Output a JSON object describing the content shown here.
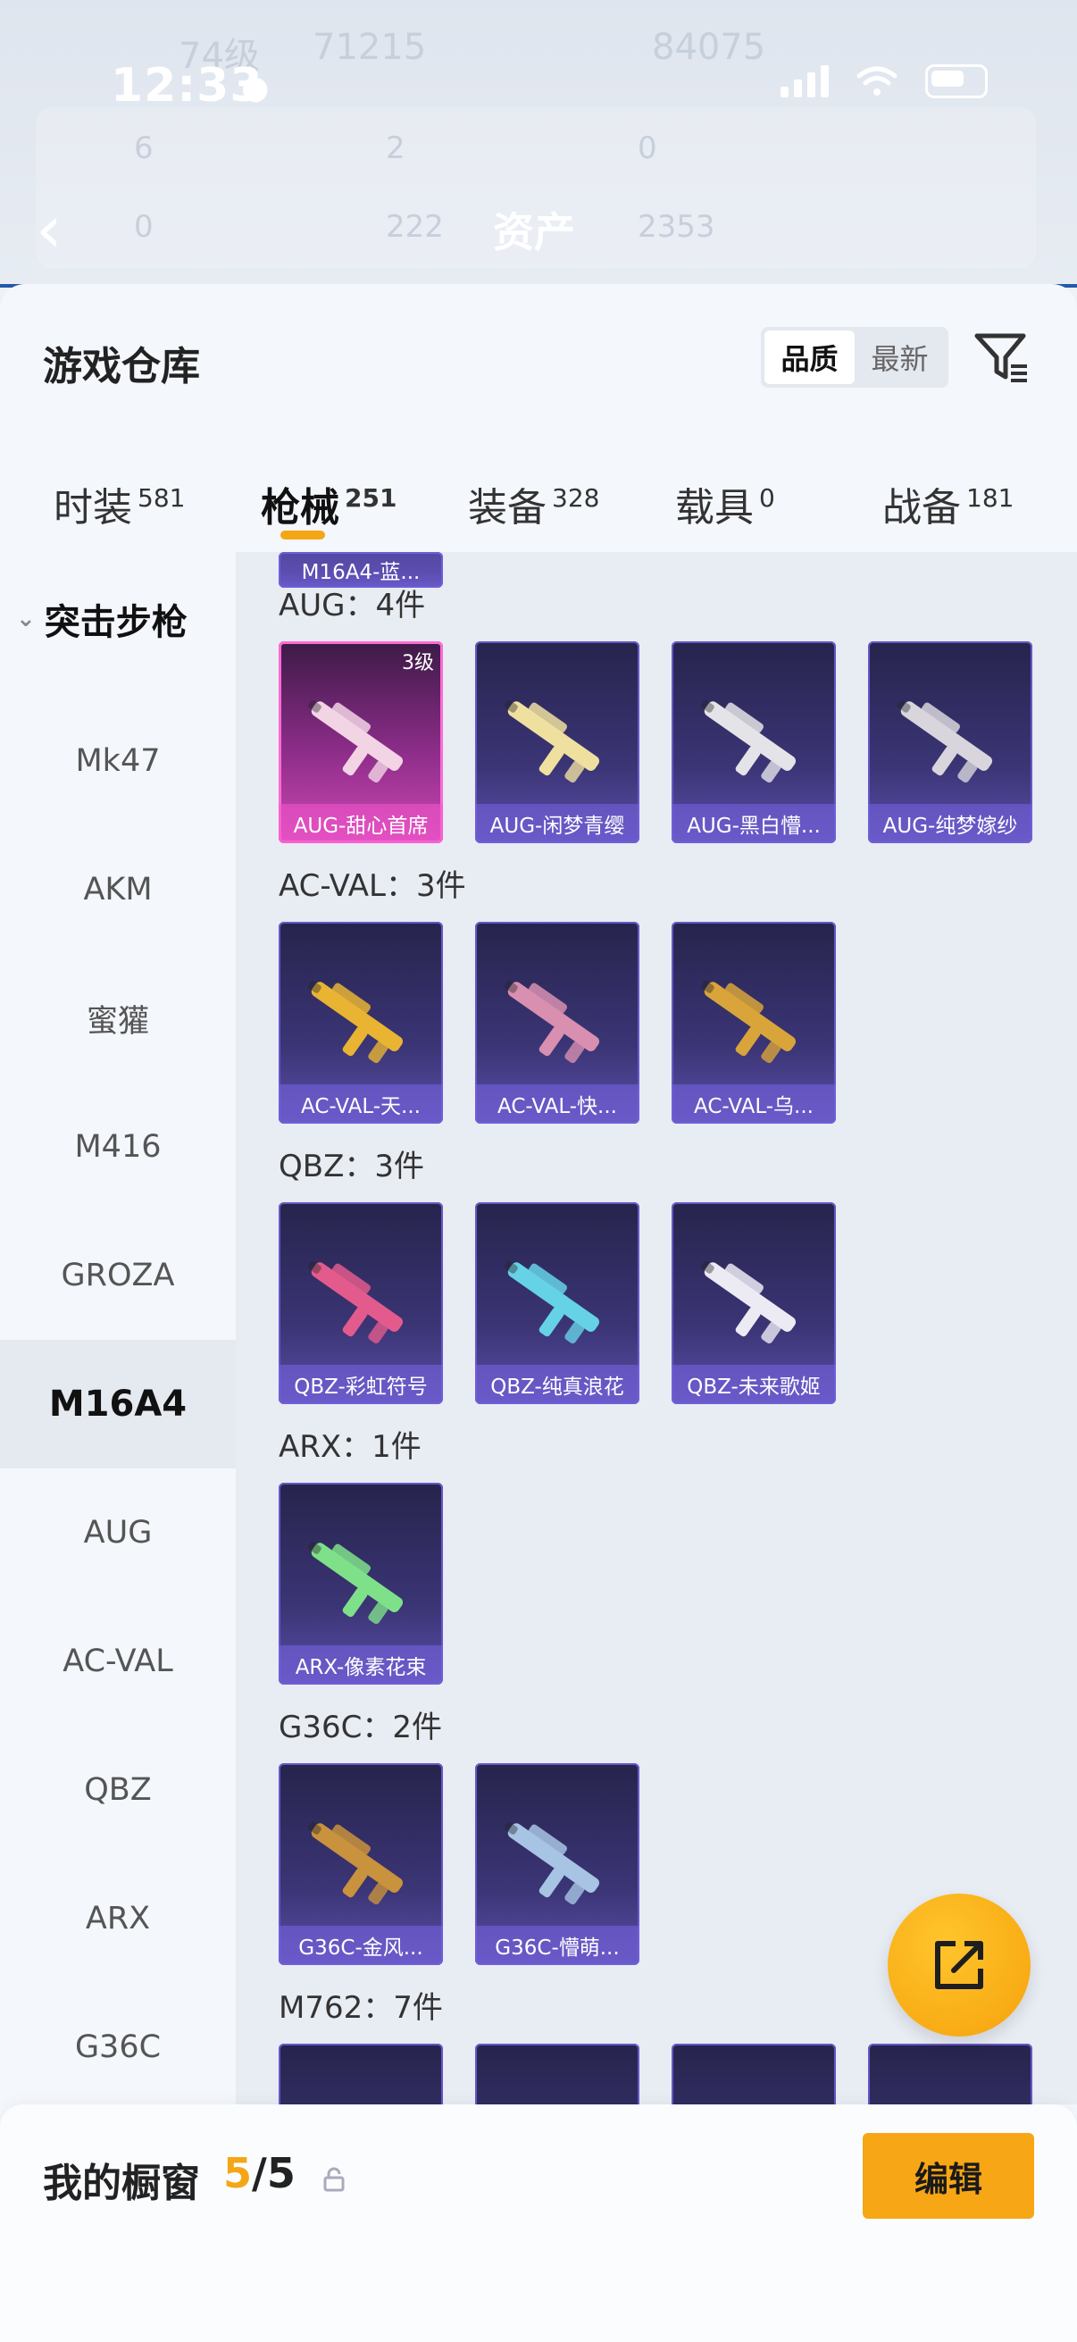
{
  "status_bar": {
    "time": "12:33"
  },
  "header_ghost": {
    "line1_left": "74级",
    "line1_mid": "71215",
    "line1_right": "84075",
    "row2": [
      "6",
      "2",
      "0"
    ],
    "row3_left": "0",
    "row3_mid": "222",
    "row3_right": "2353",
    "title": "资产"
  },
  "sheet": {
    "title": "游戏仓库",
    "sort_options": [
      {
        "label": "品质",
        "active": true
      },
      {
        "label": "最新",
        "active": false
      }
    ]
  },
  "tabs": [
    {
      "label": "时装",
      "count": "581"
    },
    {
      "label": "枪械",
      "count": "251",
      "active": true
    },
    {
      "label": "装备",
      "count": "328"
    },
    {
      "label": "载具",
      "count": "0"
    },
    {
      "label": "战备",
      "count": "181"
    }
  ],
  "sidebar": {
    "category": "突击步枪",
    "items": [
      "Mk47",
      "AKM",
      "蜜獾",
      "M416",
      "GROZA",
      "M16A4",
      "AUG",
      "AC-VAL",
      "QBZ",
      "ARX",
      "G36C"
    ],
    "active": "M16A4"
  },
  "content": {
    "stub_label": "M16A4-蓝...",
    "sections": [
      {
        "title": "AUG：4件",
        "items": [
          {
            "label": "AUG-甜心首席",
            "level": "3级",
            "rarity": "pink",
            "color": "#f2d4e4"
          },
          {
            "label": "AUG-闲梦青缨",
            "color": "#efe0a0"
          },
          {
            "label": "AUG-黑白懵...",
            "color": "#e4e4e8"
          },
          {
            "label": "AUG-纯梦嫁纱",
            "color": "#d8d6dc"
          }
        ]
      },
      {
        "title": "AC-VAL：3件",
        "items": [
          {
            "label": "AC-VAL-天...",
            "color": "#e8b432"
          },
          {
            "label": "AC-VAL-快...",
            "color": "#d88fb0"
          },
          {
            "label": "AC-VAL-乌...",
            "color": "#d9a43a"
          }
        ]
      },
      {
        "title": "QBZ：3件",
        "items": [
          {
            "label": "QBZ-彩虹符号",
            "color": "#e35b8c"
          },
          {
            "label": "QBZ-纯真浪花",
            "color": "#66d2e6"
          },
          {
            "label": "QBZ-未来歌姬",
            "color": "#ecebf4"
          }
        ]
      },
      {
        "title": "ARX：1件",
        "items": [
          {
            "label": "ARX-像素花束",
            "color": "#7fe08a"
          }
        ]
      },
      {
        "title": "G36C：2件",
        "items": [
          {
            "label": "G36C-金风...",
            "color": "#c9923c"
          },
          {
            "label": "G36C-懵萌...",
            "color": "#a8c4e4"
          }
        ]
      },
      {
        "title": "M762：7件",
        "items": []
      }
    ]
  },
  "bottom_bar": {
    "showcase_title": "我的橱窗",
    "current": "5",
    "separator_total": "/5",
    "edit_label": "编辑"
  }
}
